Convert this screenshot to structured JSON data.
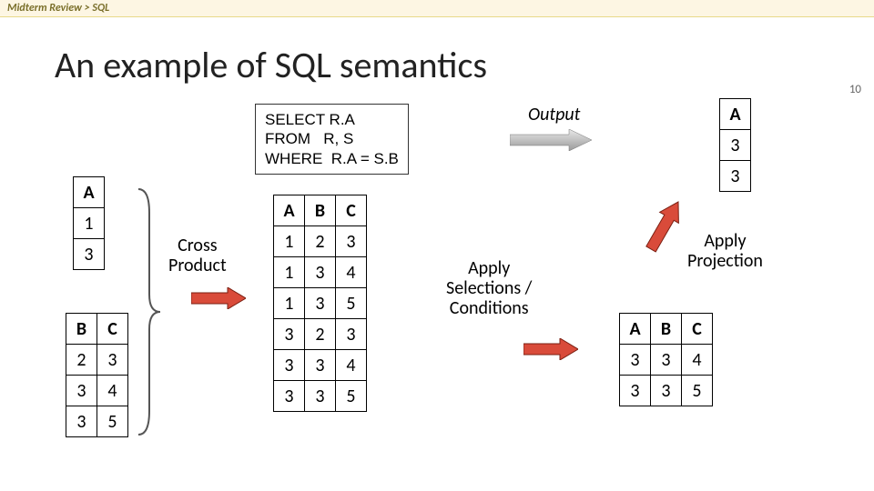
{
  "breadcrumb": "Midterm Review > SQL",
  "title": "An example of SQL semantics",
  "sql": {
    "line1": "SELECT R.A",
    "line2": "FROM   R, S",
    "line3": "WHERE  R.A = S.B"
  },
  "labels": {
    "output": "Output",
    "cross_product_1": "Cross",
    "cross_product_2": "Product",
    "apply_sel_1": "Apply",
    "apply_sel_2": "Selections /",
    "apply_sel_3": "Conditions",
    "apply_proj_1": "Apply",
    "apply_proj_2": "Projection"
  },
  "table_R": {
    "headers": [
      "A"
    ],
    "rows": [
      [
        "1"
      ],
      [
        "3"
      ]
    ]
  },
  "table_S": {
    "headers": [
      "B",
      "C"
    ],
    "rows": [
      [
        "2",
        "3"
      ],
      [
        "3",
        "4"
      ],
      [
        "3",
        "5"
      ]
    ]
  },
  "table_cross": {
    "headers": [
      "A",
      "B",
      "C"
    ],
    "rows": [
      [
        "1",
        "2",
        "3"
      ],
      [
        "1",
        "3",
        "4"
      ],
      [
        "1",
        "3",
        "5"
      ],
      [
        "3",
        "2",
        "3"
      ],
      [
        "3",
        "3",
        "4"
      ],
      [
        "3",
        "3",
        "5"
      ]
    ]
  },
  "table_sel": {
    "headers": [
      "A",
      "B",
      "C"
    ],
    "rows": [
      [
        "3",
        "3",
        "4"
      ],
      [
        "3",
        "3",
        "5"
      ]
    ]
  },
  "table_out": {
    "headers": [
      "A"
    ],
    "rows": [
      [
        "3"
      ],
      [
        "3"
      ]
    ]
  },
  "page_number": "10",
  "colors": {
    "arrow_fill_red": "#d94b3a",
    "arrow_fill_grad": "#b3b3b3"
  }
}
